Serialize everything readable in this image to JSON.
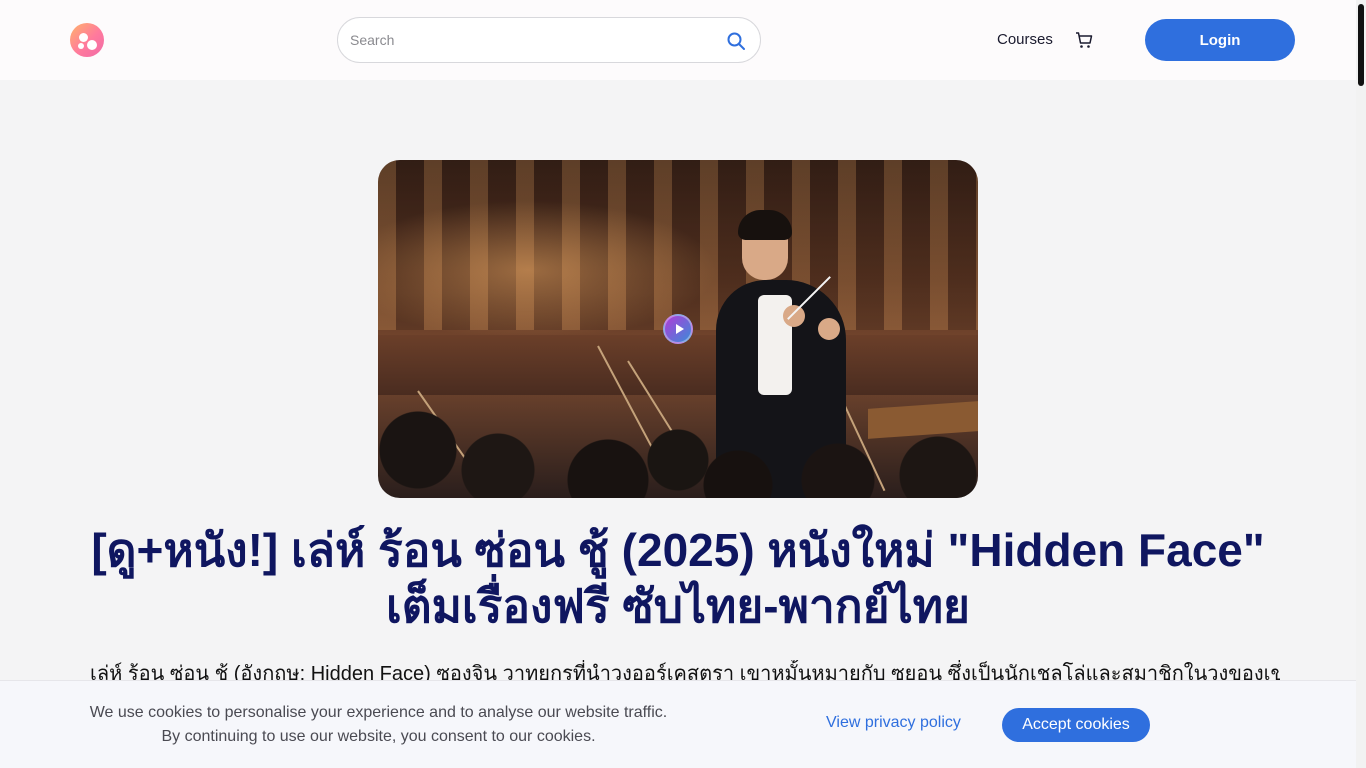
{
  "header": {
    "logo_icon": "brand-logo-icon",
    "search": {
      "placeholder": "Search",
      "value": "",
      "icon": "search-icon"
    },
    "nav": {
      "courses_label": "Courses",
      "cart_icon": "cart-icon"
    },
    "login_label": "Login"
  },
  "hero": {
    "image_description_icon": "video-thumbnail",
    "play_icon": "play-icon"
  },
  "article": {
    "title": "[ดู+หนัง!] เล่ห์ ร้อน ซ่อน ชู้ (2025) หนังใหม่ \"Hidden Face\" เต็มเรื่องฟรี ซับไทย-พากย์ไทย",
    "description": "เล่ห์ ร้อน ซ่อน ชู้ (อังกฤษ: Hidden Face) ซองจิน วาทยกรที่นำวงออร์เคสตรา เขาหมั้นหมายกับ ซูยอน ซึ่งเป็นนักเชลโล่และสมาชิกในวงของเขา"
  },
  "cookie_banner": {
    "line1": "We use cookies to personalise your experience and to analyse our website traffic.",
    "line2": "By continuing to use our website, you consent to our cookies.",
    "privacy_label": "View privacy policy",
    "accept_label": "Accept cookies"
  },
  "colors": {
    "primary": "#2f6fde",
    "title": "#0f1660",
    "background": "#f4f4f5"
  }
}
